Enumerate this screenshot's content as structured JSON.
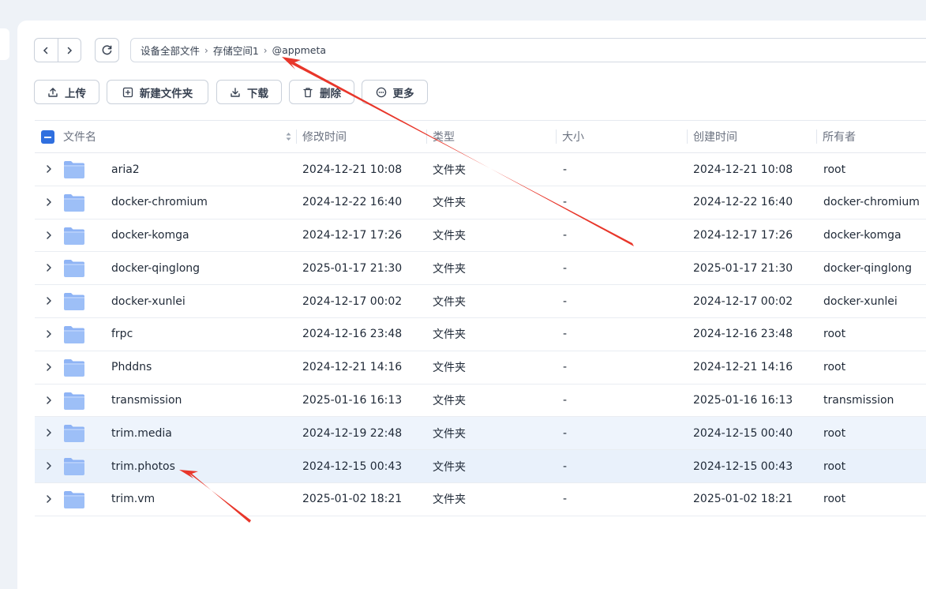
{
  "breadcrumb": {
    "items": [
      "设备全部文件",
      "存储空间1",
      "@appmeta"
    ]
  },
  "toolbar": {
    "upload": "上传",
    "new_folder": "新建文件夹",
    "download": "下载",
    "delete": "删除",
    "more": "更多"
  },
  "columns": {
    "name": "文件名",
    "modified": "修改时间",
    "type": "类型",
    "size": "大小",
    "created": "创建时间",
    "owner": "所有者"
  },
  "rows": [
    {
      "name": "aria2",
      "modified": "2024-12-21 10:08",
      "type": "文件夹",
      "size": "-",
      "created": "2024-12-21 10:08",
      "owner": "root"
    },
    {
      "name": "docker-chromium",
      "modified": "2024-12-22 16:40",
      "type": "文件夹",
      "size": "-",
      "created": "2024-12-22 16:40",
      "owner": "docker-chromium"
    },
    {
      "name": "docker-komga",
      "modified": "2024-12-17 17:26",
      "type": "文件夹",
      "size": "-",
      "created": "2024-12-17 17:26",
      "owner": "docker-komga"
    },
    {
      "name": "docker-qinglong",
      "modified": "2025-01-17 21:30",
      "type": "文件夹",
      "size": "-",
      "created": "2025-01-17 21:30",
      "owner": "docker-qinglong"
    },
    {
      "name": "docker-xunlei",
      "modified": "2024-12-17 00:02",
      "type": "文件夹",
      "size": "-",
      "created": "2024-12-17 00:02",
      "owner": "docker-xunlei"
    },
    {
      "name": "frpc",
      "modified": "2024-12-16 23:48",
      "type": "文件夹",
      "size": "-",
      "created": "2024-12-16 23:48",
      "owner": "root"
    },
    {
      "name": "Phddns",
      "modified": "2024-12-21 14:16",
      "type": "文件夹",
      "size": "-",
      "created": "2024-12-21 14:16",
      "owner": "root"
    },
    {
      "name": "transmission",
      "modified": "2025-01-16 16:13",
      "type": "文件夹",
      "size": "-",
      "created": "2025-01-16 16:13",
      "owner": "transmission"
    },
    {
      "name": "trim.media",
      "modified": "2024-12-19 22:48",
      "type": "文件夹",
      "size": "-",
      "created": "2024-12-15 00:40",
      "owner": "root"
    },
    {
      "name": "trim.photos",
      "modified": "2024-12-15 00:43",
      "type": "文件夹",
      "size": "-",
      "created": "2024-12-15 00:43",
      "owner": "root"
    },
    {
      "name": "trim.vm",
      "modified": "2025-01-02 18:21",
      "type": "文件夹",
      "size": "-",
      "created": "2025-01-02 18:21",
      "owner": "root"
    }
  ],
  "colors": {
    "accent": "#2f6fdf",
    "folder": "#8fb4f5",
    "annotation_arrow": "#e8362a"
  }
}
